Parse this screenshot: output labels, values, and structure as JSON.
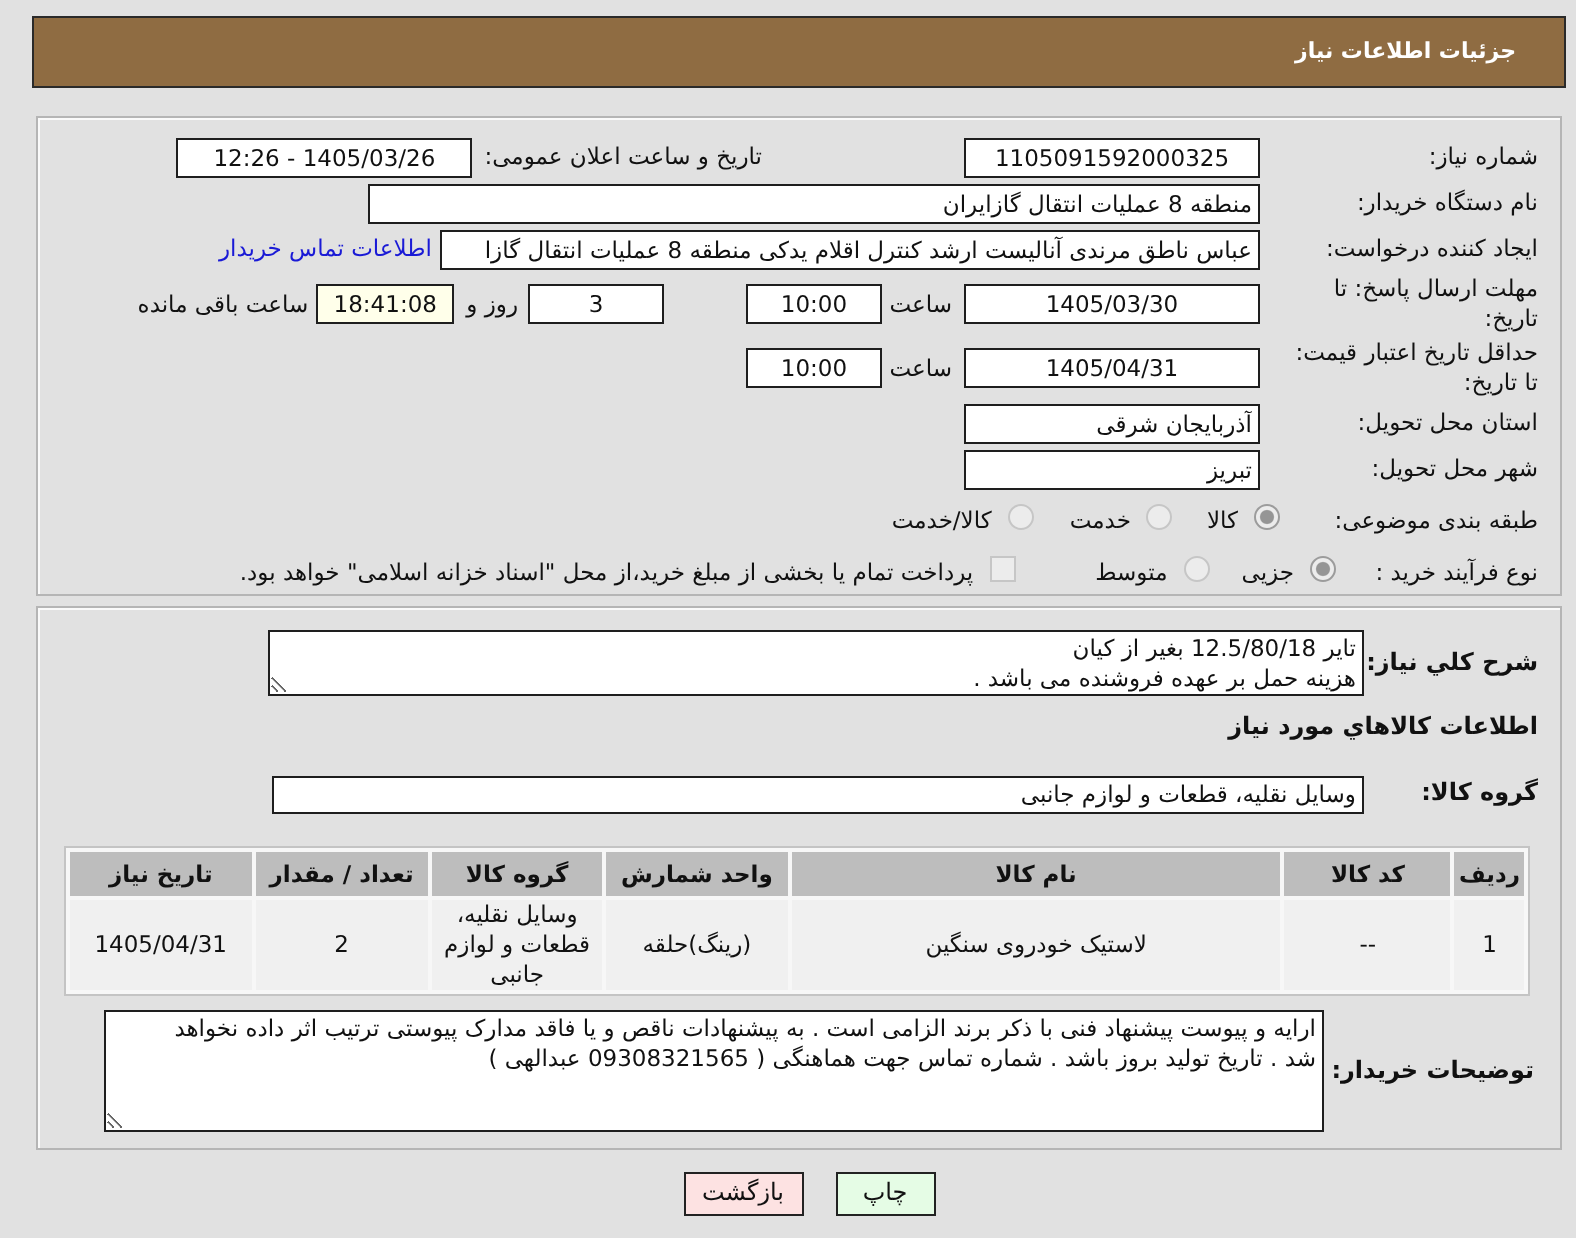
{
  "header": {
    "title": "جزئیات اطلاعات نیاز"
  },
  "details": {
    "need_number": {
      "label": "شماره نیاز:",
      "value": "1105091592000325"
    },
    "announce_datetime": {
      "label": "تاریخ و ساعت اعلان عمومی:",
      "value": "1405/03/26 - 12:26"
    },
    "buyer_org": {
      "label": "نام دستگاه خریدار:",
      "value": "منطقه 8 عملیات انتقال گازایران"
    },
    "requester": {
      "label": "ایجاد کننده درخواست:",
      "value": "عباس ناطق مرندی آنالیست ارشد کنترل اقلام یدکی منطقه 8 عملیات انتقال گازا",
      "contact_link": "اطلاعات تماس خریدار"
    },
    "reply_deadline": {
      "label": "مهلت ارسال پاسخ: تا تاریخ:",
      "date": "1405/03/30",
      "time_label": "ساعت",
      "time": "10:00",
      "days": "3",
      "days_label": "روز و",
      "remaining": "18:41:08",
      "remaining_label": "ساعت باقی مانده"
    },
    "price_validity": {
      "label": "حداقل تاریخ اعتبار قیمت: تا تاریخ:",
      "date": "1405/04/31",
      "time_label": "ساعت",
      "time": "10:00"
    },
    "province": {
      "label": "استان محل تحویل:",
      "value": "آذربایجان شرقی"
    },
    "city": {
      "label": "شهر محل تحویل:",
      "value": "تبریز"
    },
    "category": {
      "label": "طبقه بندی موضوعی:",
      "options": [
        {
          "label": "کالا",
          "selected": true,
          "disabled": true
        },
        {
          "label": "خدمت",
          "selected": false,
          "disabled": true
        },
        {
          "label": "کالا/خدمت",
          "selected": false,
          "disabled": true
        }
      ]
    },
    "purchase_type": {
      "label": "نوع فرآیند خرید :",
      "options": [
        {
          "label": "جزیی",
          "selected": true,
          "disabled": true
        },
        {
          "label": "متوسط",
          "selected": false,
          "disabled": true
        }
      ],
      "treasury": {
        "label": "پرداخت تمام یا بخشی از مبلغ خرید،از محل \"اسناد خزانه اسلامی\" خواهد بود.",
        "checked": false,
        "disabled": true
      }
    }
  },
  "description": {
    "label": "شرح کلي نیاز:",
    "text": "تایر 12.5/80/18 بغیر از کیان\nهزینه حمل بر عهده فروشنده می باشد ."
  },
  "goods": {
    "heading": "اطلاعات کالاهاي مورد نیاز",
    "group_label": "گروه کالا:",
    "group_value": "وسایل نقلیه، قطعات و لوازم جانبی",
    "table": {
      "columns": [
        "ردیف",
        "کد کالا",
        "نام کالا",
        "واحد شمارش",
        "گروه کالا",
        "تعداد / مقدار",
        "تاریخ نیاز"
      ],
      "rows": [
        [
          "1",
          "--",
          "لاستیک خودروی سنگین",
          "(رینگ)حلقه",
          "وسایل نقلیه، قطعات و لوازم جانبی",
          "2",
          "1405/04/31"
        ]
      ]
    }
  },
  "buyer_notes": {
    "label": "توضیحات خریدار:",
    "text": "ارایه و پیوست پیشنهاد فنی با ذکر برند الزامی است . به پیشنهادات ناقص و یا فاقد مدارک پیوستی ترتیب اثر داده نخواهد شد . تاریخ تولید بروز باشد . شماره تماس جهت هماهنگی ( 09308321565 عبدالهی )"
  },
  "buttons": [
    {
      "label": "چاپ",
      "kind": "print"
    },
    {
      "label": "بازگشت",
      "kind": "back"
    }
  ]
}
